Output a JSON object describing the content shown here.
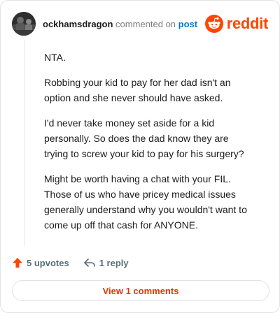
{
  "comment": {
    "username": "ockhamsdragon",
    "verb": "commented on",
    "post_link": "post",
    "body": [
      "NTA.",
      "Robbing your kid to pay for her dad isn't an option and she never should have asked.",
      "I'd never take money set aside for a kid personally. So does the dad know they are trying to screw your kid to pay for his surgery?",
      "Might be worth having a chat with your FIL. Those of us who have pricey medical issues generally understand why you wouldn't want to come up off that cash for ANYONE."
    ]
  },
  "brand": {
    "wordmark": "reddit",
    "color": "#ff4500"
  },
  "actions": {
    "upvotes": "5 upvotes",
    "replies": "1 reply",
    "upvote_color": "#ff4500"
  },
  "footer": {
    "view_comments": "View 1 comments"
  },
  "icons": {
    "avatar": "user-avatar",
    "logo": "reddit-snoo-icon",
    "upvote": "upvote-arrow-icon",
    "reply": "reply-arrow-icon"
  }
}
